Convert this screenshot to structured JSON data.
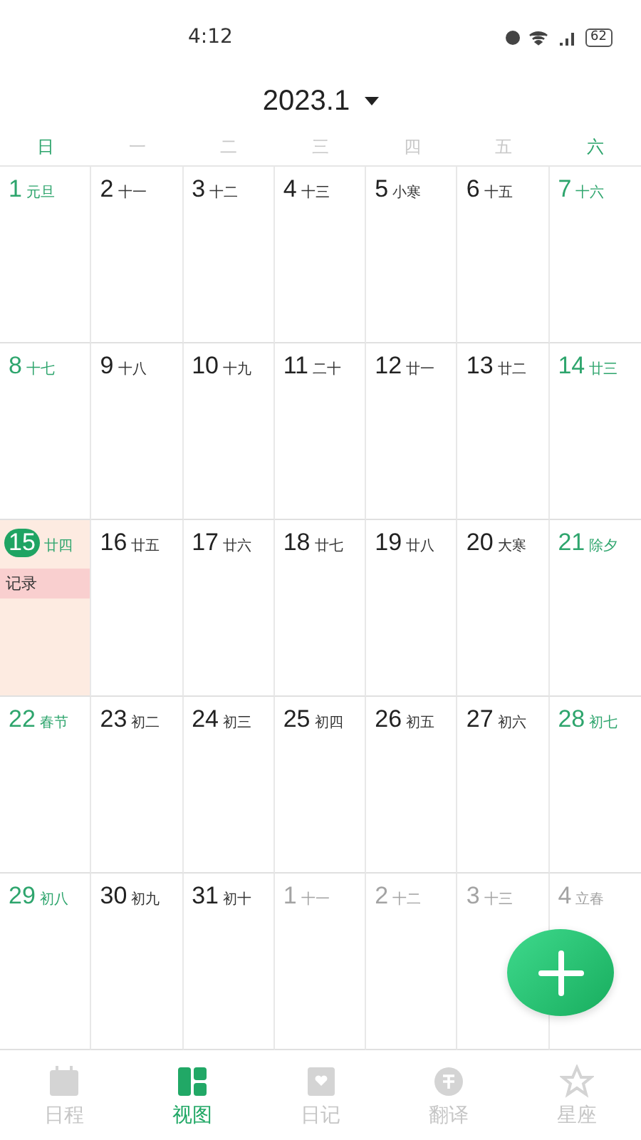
{
  "status_bar": {
    "time": "4:12",
    "battery": "62"
  },
  "header": {
    "title": "2023.1"
  },
  "weekdays": [
    {
      "label": "日",
      "weekend": true
    },
    {
      "label": "一",
      "weekend": false
    },
    {
      "label": "二",
      "weekend": false
    },
    {
      "label": "三",
      "weekend": false
    },
    {
      "label": "四",
      "weekend": false
    },
    {
      "label": "五",
      "weekend": false
    },
    {
      "label": "六",
      "weekend": true
    }
  ],
  "weeks": [
    [
      {
        "day": "1",
        "lunar": "元旦",
        "kind": "weekend",
        "today": false
      },
      {
        "day": "2",
        "lunar": "十一",
        "kind": "weekday",
        "today": false
      },
      {
        "day": "3",
        "lunar": "十二",
        "kind": "weekday",
        "today": false
      },
      {
        "day": "4",
        "lunar": "十三",
        "kind": "weekday",
        "today": false
      },
      {
        "day": "5",
        "lunar": "小寒",
        "kind": "weekday",
        "today": false
      },
      {
        "day": "6",
        "lunar": "十五",
        "kind": "weekday",
        "today": false
      },
      {
        "day": "7",
        "lunar": "十六",
        "kind": "weekend",
        "today": false
      }
    ],
    [
      {
        "day": "8",
        "lunar": "十七",
        "kind": "weekend",
        "today": false
      },
      {
        "day": "9",
        "lunar": "十八",
        "kind": "weekday",
        "today": false
      },
      {
        "day": "10",
        "lunar": "十九",
        "kind": "weekday",
        "today": false
      },
      {
        "day": "11",
        "lunar": "二十",
        "kind": "weekday",
        "today": false
      },
      {
        "day": "12",
        "lunar": "廿一",
        "kind": "weekday",
        "today": false
      },
      {
        "day": "13",
        "lunar": "廿二",
        "kind": "weekday",
        "today": false
      },
      {
        "day": "14",
        "lunar": "廿三",
        "kind": "weekend",
        "today": false
      }
    ],
    [
      {
        "day": "15",
        "lunar": "廿四",
        "kind": "weekend",
        "today": true,
        "events": [
          "记录"
        ]
      },
      {
        "day": "16",
        "lunar": "廿五",
        "kind": "weekday",
        "today": false
      },
      {
        "day": "17",
        "lunar": "廿六",
        "kind": "weekday",
        "today": false
      },
      {
        "day": "18",
        "lunar": "廿七",
        "kind": "weekday",
        "today": false
      },
      {
        "day": "19",
        "lunar": "廿八",
        "kind": "weekday",
        "today": false
      },
      {
        "day": "20",
        "lunar": "大寒",
        "kind": "weekday",
        "today": false
      },
      {
        "day": "21",
        "lunar": "除夕",
        "kind": "weekend",
        "today": false
      }
    ],
    [
      {
        "day": "22",
        "lunar": "春节",
        "kind": "weekend",
        "today": false
      },
      {
        "day": "23",
        "lunar": "初二",
        "kind": "weekday",
        "today": false
      },
      {
        "day": "24",
        "lunar": "初三",
        "kind": "weekday",
        "today": false
      },
      {
        "day": "25",
        "lunar": "初四",
        "kind": "weekday",
        "today": false
      },
      {
        "day": "26",
        "lunar": "初五",
        "kind": "weekday",
        "today": false
      },
      {
        "day": "27",
        "lunar": "初六",
        "kind": "weekday",
        "today": false
      },
      {
        "day": "28",
        "lunar": "初七",
        "kind": "weekend",
        "today": false
      }
    ],
    [
      {
        "day": "29",
        "lunar": "初八",
        "kind": "weekend",
        "today": false
      },
      {
        "day": "30",
        "lunar": "初九",
        "kind": "weekday",
        "today": false
      },
      {
        "day": "31",
        "lunar": "初十",
        "kind": "weekday",
        "today": false
      },
      {
        "day": "1",
        "lunar": "十一",
        "kind": "other",
        "today": false
      },
      {
        "day": "2",
        "lunar": "十二",
        "kind": "other",
        "today": false
      },
      {
        "day": "3",
        "lunar": "十三",
        "kind": "other",
        "today": false
      },
      {
        "day": "4",
        "lunar": "立春",
        "kind": "other",
        "today": false
      }
    ]
  ],
  "tabs": [
    {
      "label": "日程",
      "kind": "calendar",
      "selected": false
    },
    {
      "label": "视图",
      "kind": "layout",
      "selected": true
    },
    {
      "label": "日记",
      "kind": "diary",
      "selected": false
    },
    {
      "label": "翻译",
      "kind": "translate",
      "selected": false
    },
    {
      "label": "星座",
      "kind": "star",
      "selected": false
    }
  ]
}
